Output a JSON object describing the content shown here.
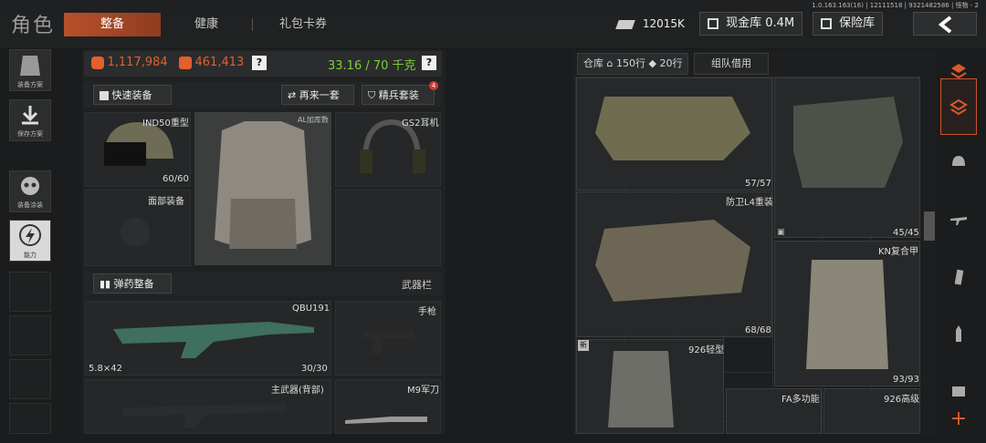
{
  "header": {
    "title": "角色",
    "tabs": [
      {
        "label": "整备",
        "active": true
      },
      {
        "label": "健康",
        "active": false
      },
      {
        "label": "礼包卡券",
        "active": false
      }
    ],
    "version": "1.0.163.163(16) | 12111518 | 9321482586 | 怪物 - 2",
    "money": "12015K",
    "cash_vault": "现金库 0.4M",
    "safe_box": "保险库"
  },
  "sidebar": {
    "items": [
      {
        "label": "装备方案",
        "icon": "vest-icon"
      },
      {
        "label": "保存方案",
        "icon": "download-icon"
      },
      {
        "label": "装备涂装",
        "icon": "skull-mask-icon"
      },
      {
        "label": "能力",
        "icon": "lightning-icon"
      }
    ]
  },
  "loadout": {
    "value_red": "1,117,984",
    "value_bag": "461,413",
    "weight": "33.16 / 70 千克",
    "help": "?",
    "quick_equip": "快速装备",
    "again": "再来一套",
    "elite": "精兵套装",
    "elite_badge": "4",
    "helmet": {
      "name": "IND50重型",
      "durability": "60/60"
    },
    "armor": {
      "name": "AL加库数"
    },
    "headset": {
      "name": "GS2耳机"
    },
    "face": {
      "name": "面部装备"
    },
    "ammo_btn": "弹药整备",
    "weapon_bar": "武器栏",
    "primary": {
      "name": "QBU191",
      "caliber": "5.8×42",
      "ammo": "30/30"
    },
    "pistol": {
      "name": "手枪"
    },
    "primary_back": {
      "name": "主武器(背部)"
    },
    "knife": {
      "name": "M9军刀"
    }
  },
  "warehouse": {
    "tab": "仓库",
    "rows1": "150行",
    "rows2": "20行",
    "team": "组队借用",
    "items": [
      {
        "durability": "57/57"
      },
      {
        "name": "防卫L4重装"
      },
      {
        "durability": "45/45"
      },
      {
        "name": "KN复合甲"
      },
      {
        "durability": "68/68"
      },
      {
        "name": "926轻型",
        "tag": "新"
      },
      {
        "durability": "93/93"
      },
      {
        "name": "FA多功能"
      },
      {
        "name": "926高级"
      }
    ]
  },
  "colors": {
    "accent": "#c8552a",
    "green": "#7ecf3a",
    "orange": "#e2602d"
  }
}
